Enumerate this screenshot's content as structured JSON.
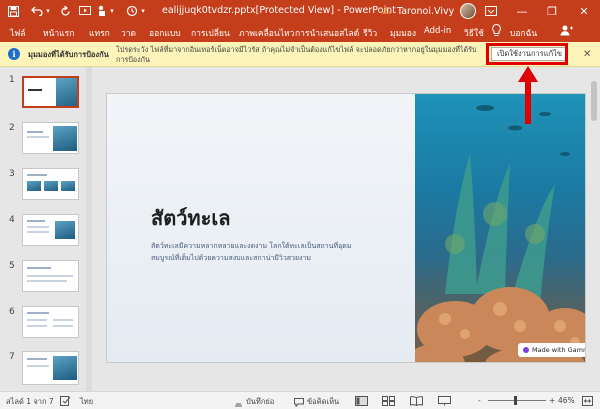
{
  "window": {
    "title": "ealijjuqk0tvdzr.pptx[Protected View] - PowerPoint",
    "user_name": "Taronoi.Vivy",
    "minimize": "—",
    "maximize": "❐",
    "close": "✕"
  },
  "ribbon": {
    "tabs": [
      "ไฟล์",
      "หน้าแรก",
      "แทรก",
      "วาด",
      "ออกแบบ",
      "การเปลี่ยน",
      "ภาพเคลื่อนไหว",
      "การนำเสนอสไลด์",
      "รีวิว",
      "มุมมอง",
      "Add-in",
      "วิธีใช้"
    ],
    "tell_me": "บอกฉัน"
  },
  "warning": {
    "title": "มุมมองที่ได้รับการป้องกัน",
    "message": "โปรดระวัง ไฟล์ที่มาจากอินเทอร์เน็ตอาจมีไวรัส ถ้าคุณไม่จำเป็นต้องแก้ไขไฟล์ จะปลอดภัยกว่าหากอยู่ในมุมมองที่ได้รับการป้องกัน",
    "enable_editing": "เปิดใช้งานการแก้ไข",
    "close": "✕"
  },
  "thumbnails": [
    "1",
    "2",
    "3",
    "4",
    "5",
    "6",
    "7"
  ],
  "slide": {
    "title": "สัตว์ทะเล",
    "body": "สัตว์ทะเลมีความหลากหลายและงดงาม โลกใต้ทะเลเป็นสถานที่อุดมสมบูรณ์ที่เต็มไปด้วยความสงบและสกาน่ามีวิวสวยงาม",
    "badge": "Made with Gamma"
  },
  "status": {
    "slide_info": "สไลด์ 1 จาก 7",
    "language": "ไทย",
    "notes": "บันทึกย่อ",
    "comments": "ข้อคิดเห็น",
    "zoom_minus": "-",
    "zoom_plus": "+",
    "zoom_level": "46%"
  },
  "colors": {
    "accent": "#c43e1c",
    "warning_bg": "#fcf4b8",
    "highlight": "#e00000"
  }
}
